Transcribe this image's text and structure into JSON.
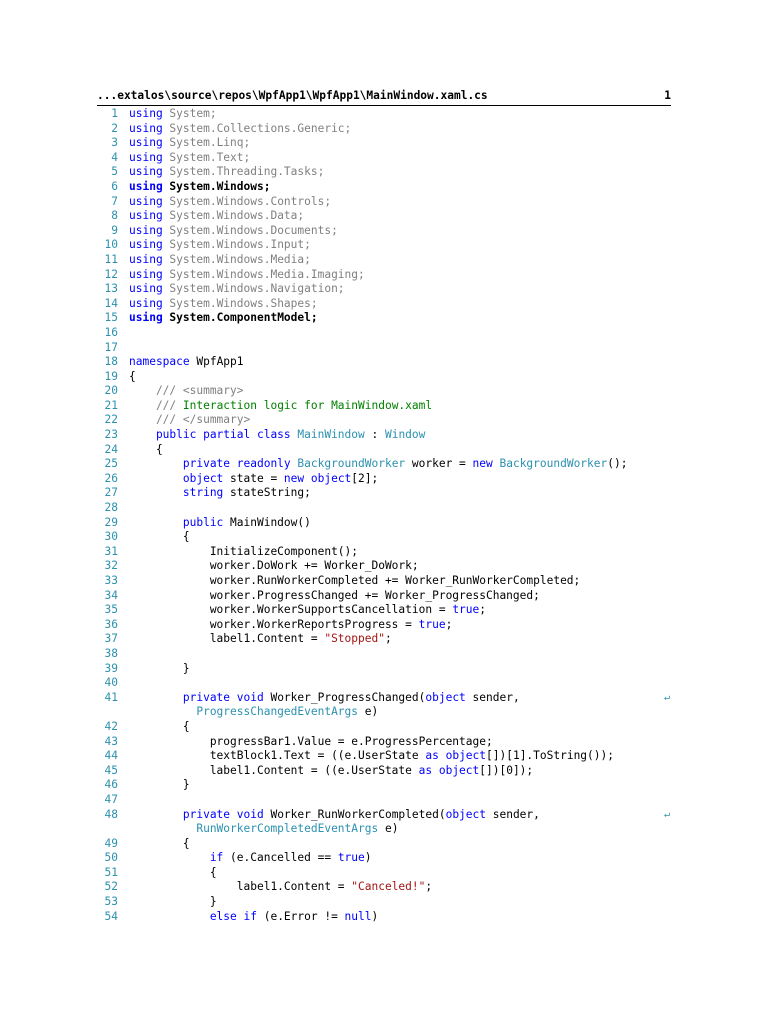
{
  "header": {
    "path": "...extalos\\source\\repos\\WpfApp1\\WpfApp1\\MainWindow.xaml.cs",
    "page": "1"
  },
  "lines": [
    {
      "n": "1",
      "seg": [
        [
          "using",
          "k"
        ],
        [
          " System;",
          "d"
        ]
      ]
    },
    {
      "n": "2",
      "seg": [
        [
          "using",
          "k"
        ],
        [
          " System.Collections.Generic;",
          "d"
        ]
      ]
    },
    {
      "n": "3",
      "seg": [
        [
          "using",
          "k"
        ],
        [
          " System.Linq;",
          "d"
        ]
      ]
    },
    {
      "n": "4",
      "seg": [
        [
          "using",
          "k"
        ],
        [
          " System.Text;",
          "d"
        ]
      ]
    },
    {
      "n": "5",
      "seg": [
        [
          "using",
          "k"
        ],
        [
          " System.Threading.Tasks;",
          "d"
        ]
      ]
    },
    {
      "n": "6",
      "seg": [
        [
          "using",
          "k b"
        ],
        [
          " System.Windows;",
          "n b"
        ]
      ]
    },
    {
      "n": "7",
      "seg": [
        [
          "using",
          "k"
        ],
        [
          " System.Windows.Controls;",
          "d"
        ]
      ]
    },
    {
      "n": "8",
      "seg": [
        [
          "using",
          "k"
        ],
        [
          " System.Windows.Data;",
          "d"
        ]
      ]
    },
    {
      "n": "9",
      "seg": [
        [
          "using",
          "k"
        ],
        [
          " System.Windows.Documents;",
          "d"
        ]
      ]
    },
    {
      "n": "10",
      "seg": [
        [
          "using",
          "k"
        ],
        [
          " System.Windows.Input;",
          "d"
        ]
      ]
    },
    {
      "n": "11",
      "seg": [
        [
          "using",
          "k"
        ],
        [
          " System.Windows.Media;",
          "d"
        ]
      ]
    },
    {
      "n": "12",
      "seg": [
        [
          "using",
          "k"
        ],
        [
          " System.Windows.Media.Imaging;",
          "d"
        ]
      ]
    },
    {
      "n": "13",
      "seg": [
        [
          "using",
          "k"
        ],
        [
          " System.Windows.Navigation;",
          "d"
        ]
      ]
    },
    {
      "n": "14",
      "seg": [
        [
          "using",
          "k"
        ],
        [
          " System.Windows.Shapes;",
          "d"
        ]
      ]
    },
    {
      "n": "15",
      "seg": [
        [
          "using",
          "k b"
        ],
        [
          " System.ComponentModel;",
          "n b"
        ]
      ]
    },
    {
      "n": "16",
      "seg": []
    },
    {
      "n": "17",
      "seg": []
    },
    {
      "n": "18",
      "seg": [
        [
          "namespace",
          "k"
        ],
        [
          " WpfApp1",
          "n"
        ]
      ]
    },
    {
      "n": "19",
      "seg": [
        [
          "{",
          "n"
        ]
      ]
    },
    {
      "n": "20",
      "seg": [
        [
          "    /// <summary>",
          "g"
        ]
      ]
    },
    {
      "n": "21",
      "seg": [
        [
          "    ///",
          "g"
        ],
        [
          " Interaction logic for MainWindow.xaml",
          "c"
        ]
      ]
    },
    {
      "n": "22",
      "seg": [
        [
          "    /// </summary>",
          "g"
        ]
      ]
    },
    {
      "n": "23",
      "seg": [
        [
          "    public partial class",
          "k"
        ],
        [
          " MainWindow",
          "t"
        ],
        [
          " : ",
          "n"
        ],
        [
          "Window",
          "t"
        ]
      ]
    },
    {
      "n": "24",
      "seg": [
        [
          "    {",
          "n"
        ]
      ]
    },
    {
      "n": "25",
      "seg": [
        [
          "        private readonly",
          "k"
        ],
        [
          " BackgroundWorker",
          "t"
        ],
        [
          " worker = ",
          "n"
        ],
        [
          "new",
          "k"
        ],
        [
          " BackgroundWorker",
          "t"
        ],
        [
          "();",
          "n"
        ]
      ]
    },
    {
      "n": "26",
      "seg": [
        [
          "        object",
          "k"
        ],
        [
          " state = ",
          "n"
        ],
        [
          "new",
          "k"
        ],
        [
          " object",
          "k"
        ],
        [
          "[2];",
          "n"
        ]
      ]
    },
    {
      "n": "27",
      "seg": [
        [
          "        string",
          "k"
        ],
        [
          " stateString;",
          "n"
        ]
      ]
    },
    {
      "n": "28",
      "seg": []
    },
    {
      "n": "29",
      "seg": [
        [
          "        public",
          "k"
        ],
        [
          " MainWindow()",
          "n"
        ]
      ]
    },
    {
      "n": "30",
      "seg": [
        [
          "        {",
          "n"
        ]
      ]
    },
    {
      "n": "31",
      "seg": [
        [
          "            InitializeComponent();",
          "n"
        ]
      ]
    },
    {
      "n": "32",
      "seg": [
        [
          "            worker.DoWork += Worker_DoWork;",
          "n"
        ]
      ]
    },
    {
      "n": "33",
      "seg": [
        [
          "            worker.RunWorkerCompleted += Worker_RunWorkerCompleted;",
          "n"
        ]
      ]
    },
    {
      "n": "34",
      "seg": [
        [
          "            worker.ProgressChanged += Worker_ProgressChanged;",
          "n"
        ]
      ]
    },
    {
      "n": "35",
      "seg": [
        [
          "            worker.WorkerSupportsCancellation = ",
          "n"
        ],
        [
          "true",
          "k"
        ],
        [
          ";",
          "n"
        ]
      ]
    },
    {
      "n": "36",
      "seg": [
        [
          "            worker.WorkerReportsProgress = ",
          "n"
        ],
        [
          "true",
          "k"
        ],
        [
          ";",
          "n"
        ]
      ]
    },
    {
      "n": "37",
      "seg": [
        [
          "            label1.Content = ",
          "n"
        ],
        [
          "\"Stopped\"",
          "s"
        ],
        [
          ";",
          "n"
        ]
      ]
    },
    {
      "n": "38",
      "seg": []
    },
    {
      "n": "39",
      "seg": [
        [
          "        }",
          "n"
        ]
      ]
    },
    {
      "n": "40",
      "seg": []
    },
    {
      "n": "41",
      "wrap": true,
      "seg": [
        [
          "        private void",
          "k"
        ],
        [
          " Worker_ProgressChanged(",
          "n"
        ],
        [
          "object",
          "k"
        ],
        [
          " sender,",
          "n"
        ]
      ]
    },
    {
      "n": "",
      "seg": [
        [
          "          ProgressChangedEventArgs",
          "t"
        ],
        [
          " e)",
          "n"
        ]
      ]
    },
    {
      "n": "42",
      "seg": [
        [
          "        {",
          "n"
        ]
      ]
    },
    {
      "n": "43",
      "seg": [
        [
          "            progressBar1.Value = e.ProgressPercentage;",
          "n"
        ]
      ]
    },
    {
      "n": "44",
      "seg": [
        [
          "            textBlock1.Text = ((e.UserState ",
          "n"
        ],
        [
          "as",
          "k"
        ],
        [
          " object",
          "k"
        ],
        [
          "[])[1].ToString());",
          "n"
        ]
      ]
    },
    {
      "n": "45",
      "seg": [
        [
          "            label1.Content = ((e.UserState ",
          "n"
        ],
        [
          "as",
          "k"
        ],
        [
          " object",
          "k"
        ],
        [
          "[])[0]);",
          "n"
        ]
      ]
    },
    {
      "n": "46",
      "seg": [
        [
          "        }",
          "n"
        ]
      ]
    },
    {
      "n": "47",
      "seg": []
    },
    {
      "n": "48",
      "wrap": true,
      "seg": [
        [
          "        private void",
          "k"
        ],
        [
          " Worker_RunWorkerCompleted(",
          "n"
        ],
        [
          "object",
          "k"
        ],
        [
          " sender,",
          "n"
        ]
      ]
    },
    {
      "n": "",
      "seg": [
        [
          "          RunWorkerCompletedEventArgs",
          "t"
        ],
        [
          " e)",
          "n"
        ]
      ]
    },
    {
      "n": "49",
      "seg": [
        [
          "        {",
          "n"
        ]
      ]
    },
    {
      "n": "50",
      "seg": [
        [
          "            if",
          "k"
        ],
        [
          " (e.Cancelled == ",
          "n"
        ],
        [
          "true",
          "k"
        ],
        [
          ")",
          "n"
        ]
      ]
    },
    {
      "n": "51",
      "seg": [
        [
          "            {",
          "n"
        ]
      ]
    },
    {
      "n": "52",
      "seg": [
        [
          "                label1.Content = ",
          "n"
        ],
        [
          "\"Canceled!\"",
          "s"
        ],
        [
          ";",
          "n"
        ]
      ]
    },
    {
      "n": "53",
      "seg": [
        [
          "            }",
          "n"
        ]
      ]
    },
    {
      "n": "54",
      "seg": [
        [
          "            else if",
          "k"
        ],
        [
          " (e.Error != ",
          "n"
        ],
        [
          "null",
          "k"
        ],
        [
          ")",
          "n"
        ]
      ]
    }
  ],
  "wrap_glyph": "↵"
}
